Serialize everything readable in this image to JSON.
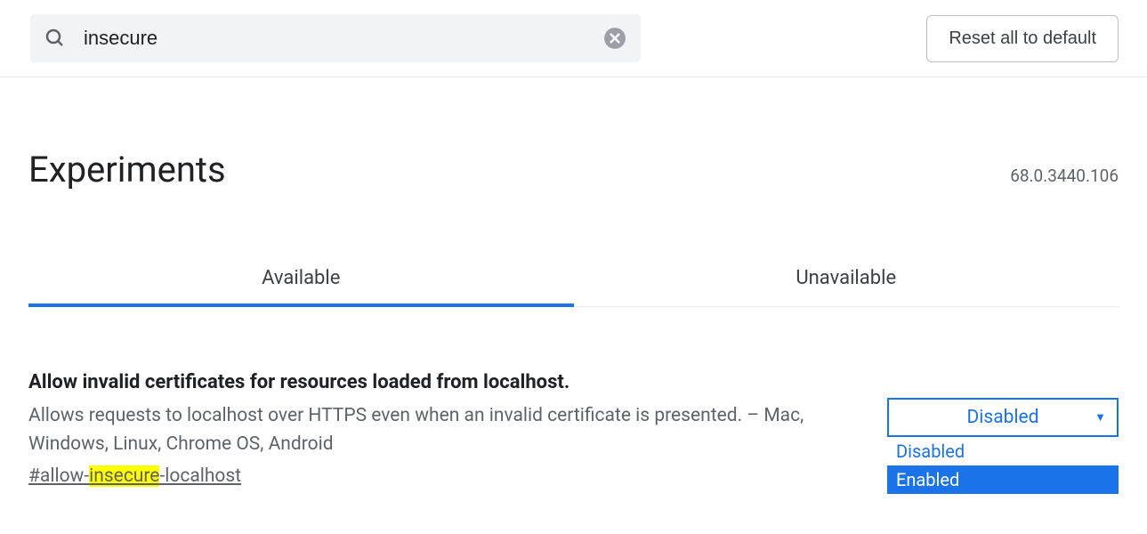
{
  "search": {
    "value": "insecure"
  },
  "reset_label": "Reset all to default",
  "title": "Experiments",
  "version": "68.0.3440.106",
  "tabs": {
    "available": "Available",
    "unavailable": "Unavailable"
  },
  "flag": {
    "title": "Allow invalid certificates for resources loaded from localhost.",
    "desc": "Allows requests to localhost over HTTPS even when an invalid certificate is presented. – Mac, Windows, Linux, Chrome OS, Android",
    "hash_pre": "#allow-",
    "hash_hl": "insecure",
    "hash_post": "-localhost",
    "selected": "Disabled",
    "options": {
      "opt1": "Disabled",
      "opt2": "Enabled"
    }
  }
}
